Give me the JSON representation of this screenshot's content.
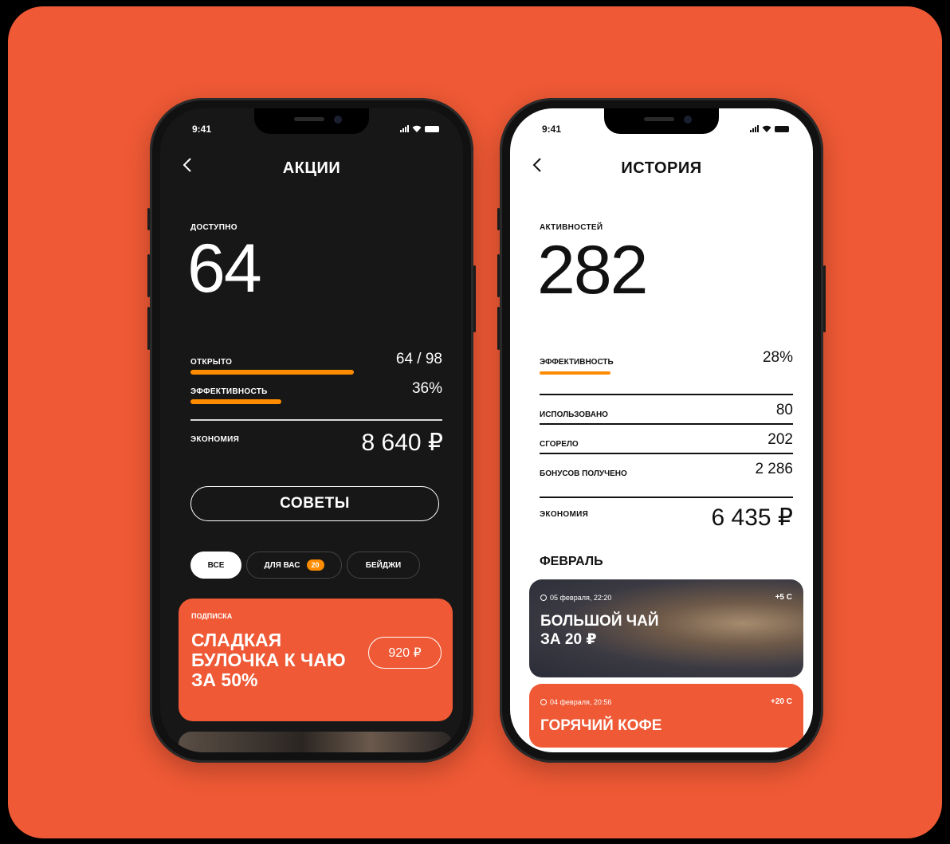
{
  "colors": {
    "accent": "#ef5935",
    "bar": "#ff8c00",
    "dark_bg": "#171717",
    "light_bg": "#ffffff"
  },
  "status_bar": {
    "time": "9:41"
  },
  "left": {
    "title": "АКЦИИ",
    "available_label": "ДОСТУПНО",
    "available_value": "64",
    "opened": {
      "label": "ОТКРЫТО",
      "value": "64 / 98",
      "fraction": 0.65
    },
    "efficiency": {
      "label": "ЭФФЕКТИВНОСТЬ",
      "value": "36%",
      "fraction": 0.36
    },
    "savings": {
      "label": "ЭКОНОМИЯ",
      "value": "8 640 ₽"
    },
    "advice_button": "СОВЕТЫ",
    "filters": [
      {
        "label": "ВСЕ"
      },
      {
        "label": "ДЛЯ ВАС",
        "badge": "20"
      },
      {
        "label": "БЕЙДЖИ"
      }
    ],
    "promo": {
      "category": "ПОДПИСКА",
      "title": "СЛАДКАЯ БУЛОЧКА К ЧАЮ ЗА 50%",
      "price": "920 ₽"
    }
  },
  "right": {
    "title": "ИСТОРИЯ",
    "activities_label": "АКТИВНОСТЕЙ",
    "activities_value": "282",
    "efficiency": {
      "label": "ЭФФЕКТИВНОСТЬ",
      "value": "28%",
      "fraction": 0.28
    },
    "stats": [
      {
        "label": "ИСПОЛЬЗОВАНО",
        "value": "80"
      },
      {
        "label": "СГОРЕЛО",
        "value": "202"
      },
      {
        "label": "БОНУСОВ ПОЛУЧЕНО",
        "value": "2 286"
      }
    ],
    "savings": {
      "label": "ЭКОНОМИЯ",
      "value": "6 435 ₽"
    },
    "month": "ФЕВРАЛЬ",
    "history": [
      {
        "date": "05 февраля, 22:20",
        "points": "+5 С",
        "title": "БОЛЬШОЙ ЧАЙ ЗА 20 ₽"
      },
      {
        "date": "04 февраля, 20:56",
        "points": "+20 С",
        "title": "ГОРЯЧИЙ КОФЕ"
      }
    ]
  }
}
